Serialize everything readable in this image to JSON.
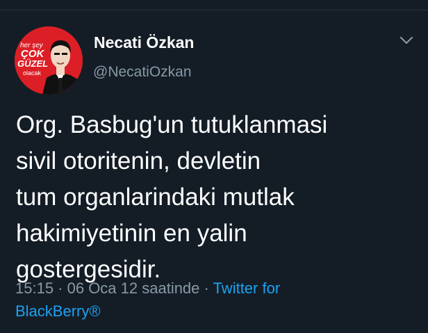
{
  "author": {
    "display_name": "Necati Özkan",
    "handle": "@NecatiOzkan",
    "avatar_text": {
      "line1": "her şey",
      "line2": "ÇOK",
      "line3": "GÜZEL",
      "line4": "olacak"
    }
  },
  "icons": {
    "menu": "chevron-down-icon"
  },
  "tweet": {
    "lines": [
      "Org. Basbug'un tutuklanmasi",
      "sivil otoritenin, devletin",
      "tum organlarindaki mutlak",
      "hakimiyetinin en yalin",
      "gostergesidir."
    ],
    "timestamp": "15:15 · 06 Oca 12 saatinde ·",
    "client_part1": "Twitter for",
    "client_part2": "BlackBerry®"
  },
  "colors": {
    "background": "#141d26",
    "text_primary": "#ffffff",
    "text_secondary": "#8899a6",
    "link": "#1da1f2",
    "avatar_red": "#dc1f26"
  }
}
